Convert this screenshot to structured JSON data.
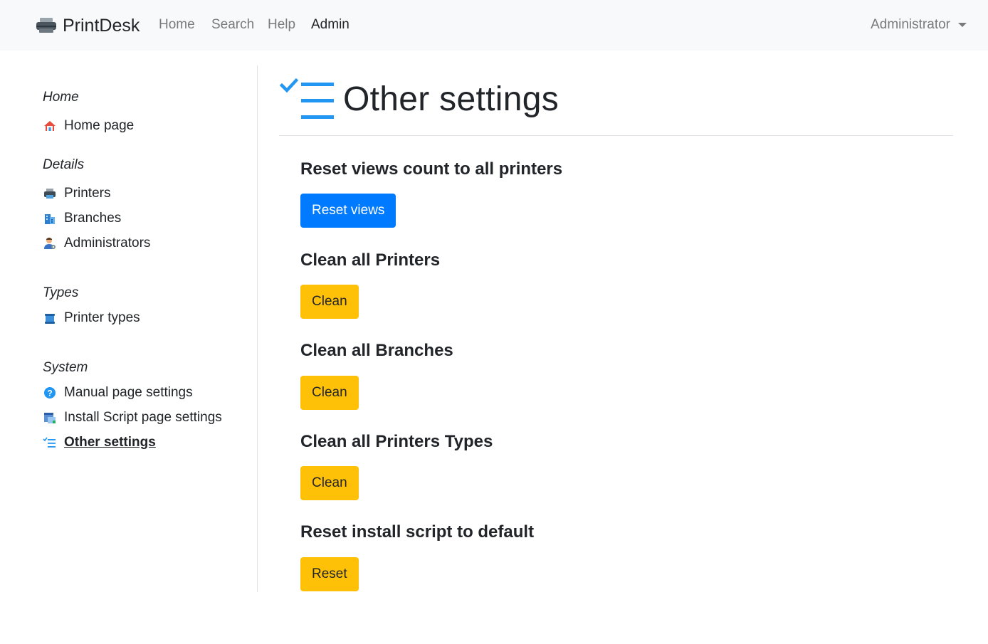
{
  "navbar": {
    "brand": "PrintDesk",
    "links": [
      "Home",
      "Search",
      "Help",
      "Admin"
    ],
    "active_link": "Admin",
    "user": "Administrator"
  },
  "sidebar": {
    "groups": [
      {
        "header": "Home",
        "items": [
          {
            "label": "Home page",
            "icon": "home-icon"
          }
        ]
      },
      {
        "header": "Details",
        "items": [
          {
            "label": "Printers",
            "icon": "printer-icon"
          },
          {
            "label": "Branches",
            "icon": "building-icon"
          },
          {
            "label": "Administrators",
            "icon": "admin-user-icon"
          }
        ]
      },
      {
        "header": "Types",
        "items": [
          {
            "label": "Printer types",
            "icon": "printer-type-icon"
          }
        ]
      },
      {
        "header": "System",
        "items": [
          {
            "label": "Manual page settings",
            "icon": "help-icon"
          },
          {
            "label": "Install Script page settings",
            "icon": "script-icon"
          },
          {
            "label": "Other settings",
            "icon": "checklist-icon"
          }
        ]
      }
    ],
    "current": "Other settings"
  },
  "main": {
    "title": "Other settings",
    "sections": [
      {
        "heading": "Reset views count to all printers",
        "button": "Reset views",
        "style": "primary"
      },
      {
        "heading": "Clean all Printers",
        "button": "Clean",
        "style": "warning"
      },
      {
        "heading": "Clean all Branches",
        "button": "Clean",
        "style": "warning"
      },
      {
        "heading": "Clean all Printers Types",
        "button": "Clean",
        "style": "warning"
      },
      {
        "heading": "Reset install script to default",
        "button": "Reset",
        "style": "warning"
      }
    ]
  },
  "colors": {
    "primary": "#007bff",
    "warning": "#ffc107",
    "navbar_bg": "#f8f9fa",
    "icon_blue": "#2196f3"
  }
}
